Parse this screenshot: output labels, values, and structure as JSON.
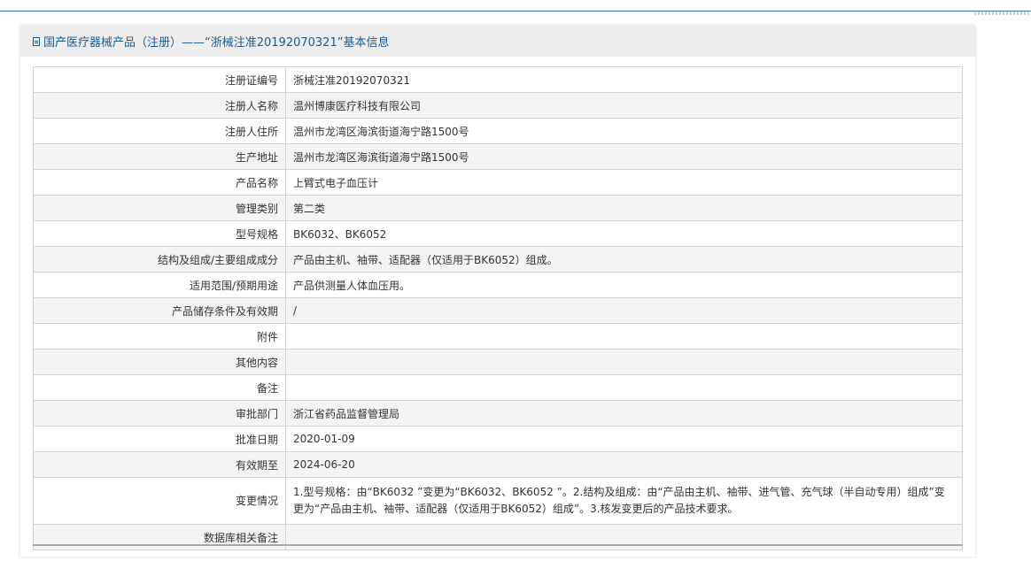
{
  "header": {
    "title": "国产医疗器械产品（注册）——“浙械注准20192070321”基本信息"
  },
  "rows": [
    {
      "key": "注册证编号",
      "value": "浙械注准20192070321"
    },
    {
      "key": "注册人名称",
      "value": "温州博康医疗科技有限公司"
    },
    {
      "key": "注册人住所",
      "value": "温州市龙湾区海滨街道海宁路1500号"
    },
    {
      "key": "生产地址",
      "value": "温州市龙湾区海滨街道海宁路1500号"
    },
    {
      "key": "产品名称",
      "value": "上臂式电子血压计"
    },
    {
      "key": "管理类别",
      "value": "第二类"
    },
    {
      "key": "型号规格",
      "value": "BK6032、BK6052"
    },
    {
      "key": "结构及组成/主要组成成分",
      "value": "产品由主机、袖带、适配器（仅适用于BK6052）组成。"
    },
    {
      "key": "适用范围/预期用途",
      "value": "产品供测量人体血压用。"
    },
    {
      "key": "产品储存条件及有效期",
      "value": "/"
    },
    {
      "key": "附件",
      "value": ""
    },
    {
      "key": "其他内容",
      "value": ""
    },
    {
      "key": "备注",
      "value": ""
    },
    {
      "key": "审批部门",
      "value": "浙江省药品监督管理局"
    },
    {
      "key": "批准日期",
      "value": "2020-01-09"
    },
    {
      "key": "有效期至",
      "value": "2024-06-20"
    },
    {
      "key": "变更情况",
      "value": "1.型号规格：由“BK6032 ”变更为“BK6032、BK6052 ”。2.结构及组成：由“产品由主机、袖带、进气管、充气球（半自动专用）组成”变更为“产品由主机、袖带、适配器（仅适用于BK6052）组成”。3.核发变更后的产品技术要求。"
    },
    {
      "key": "数据库相关备注",
      "value": ""
    }
  ]
}
